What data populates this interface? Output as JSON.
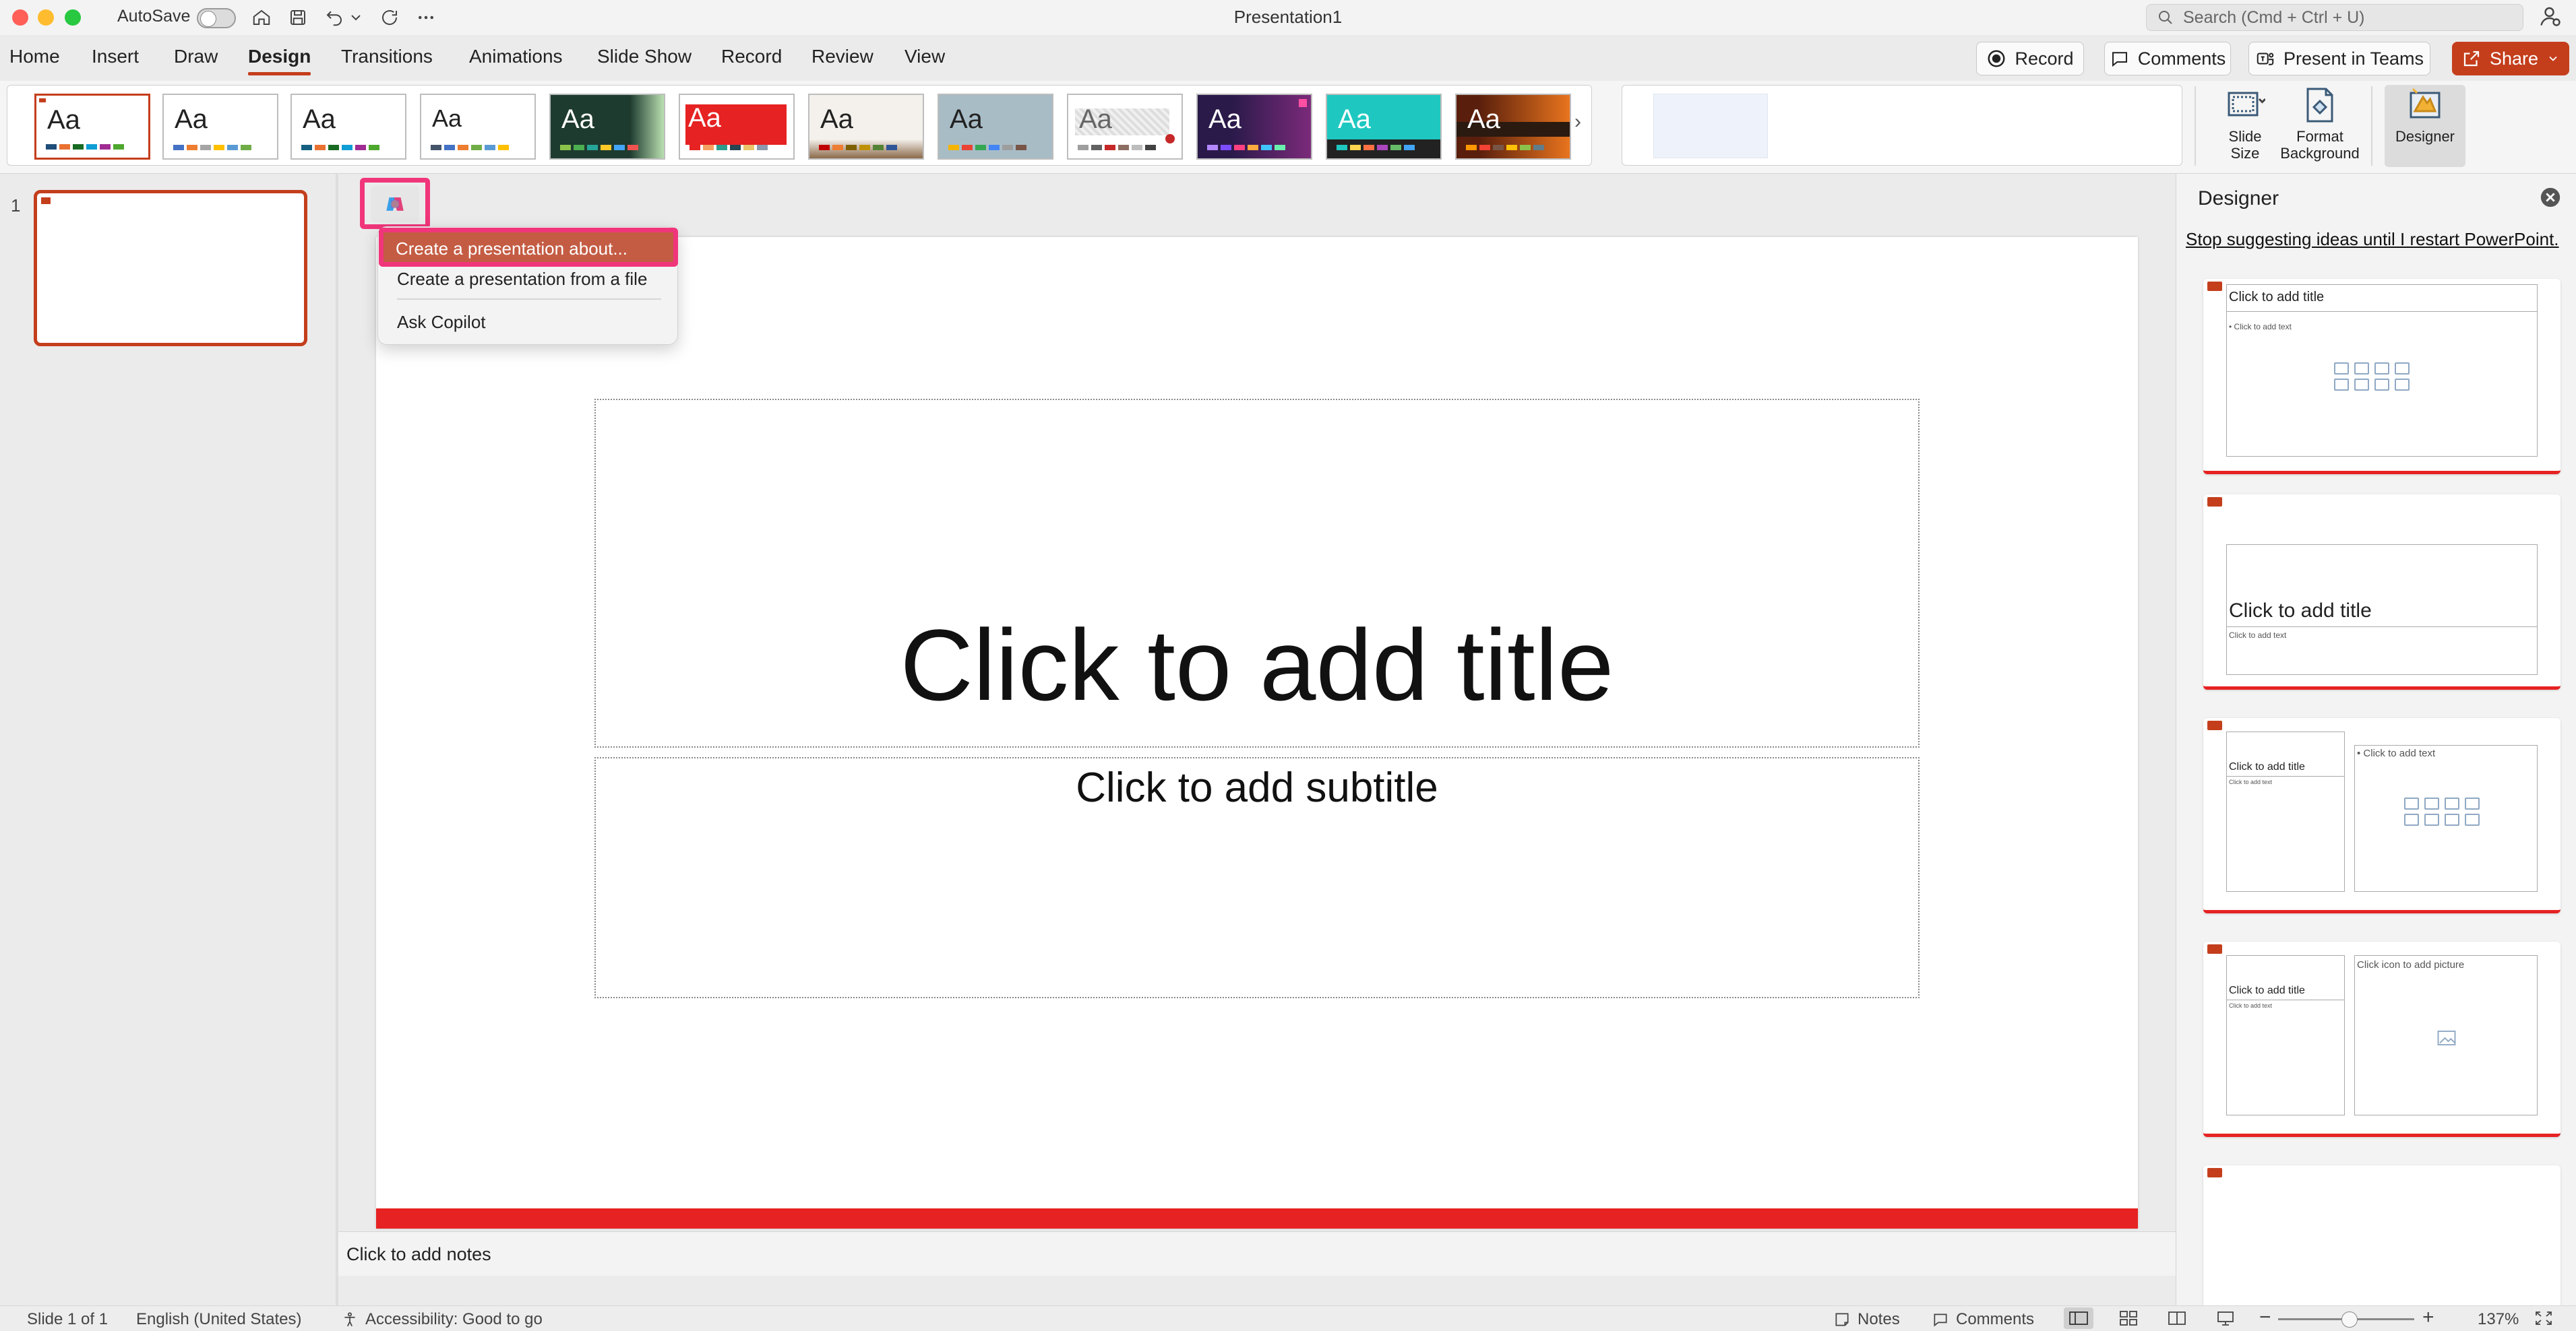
{
  "window": {
    "title": "Presentation1"
  },
  "titlebar": {
    "autosave_label": "AutoSave",
    "search_placeholder": "Search (Cmd + Ctrl + U)"
  },
  "tabs": [
    {
      "label": "Home"
    },
    {
      "label": "Insert"
    },
    {
      "label": "Draw"
    },
    {
      "label": "Design",
      "active": true
    },
    {
      "label": "Transitions"
    },
    {
      "label": "Animations"
    },
    {
      "label": "Slide Show"
    },
    {
      "label": "Record"
    },
    {
      "label": "Review"
    },
    {
      "label": "View"
    }
  ],
  "top_buttons": {
    "record": "Record",
    "comments": "Comments",
    "present_in_teams": "Present in Teams",
    "share": "Share"
  },
  "ribbon": {
    "theme_label": "Aa",
    "slide_size_label": "Slide Size",
    "format_background_label": "Format Background",
    "designer_label": "Designer"
  },
  "thumbnails": [
    {
      "number": "1"
    }
  ],
  "copilot_menu": {
    "items": [
      "Create a presentation about...",
      "Create a presentation from a file",
      "Ask Copilot"
    ]
  },
  "slide": {
    "title_placeholder": "Click to add title",
    "subtitle_placeholder": "Click to add subtitle"
  },
  "notes": {
    "placeholder": "Click to add notes"
  },
  "designer": {
    "title": "Designer",
    "stop_link": "Stop suggesting ideas until I restart PowerPoint.",
    "ideas": [
      {
        "title": "Click to add title",
        "text": "• Click to add text"
      },
      {
        "title": "Click to add title",
        "text": "Click to add text"
      },
      {
        "title": "Click to add title",
        "text": "Click to add text",
        "right": "• Click to add text"
      },
      {
        "title": "Click to add title",
        "text": "Click to add text",
        "right": "Click icon to add picture"
      }
    ]
  },
  "status": {
    "slide_count": "Slide 1 of 1",
    "language": "English (United States)",
    "accessibility": "Accessibility: Good to go",
    "notes": "Notes",
    "comments": "Comments",
    "zoom": "137%"
  },
  "colors": {
    "accent": "#c43e1c",
    "highlight": "#f0357a",
    "slide_bar": "#e62222"
  }
}
